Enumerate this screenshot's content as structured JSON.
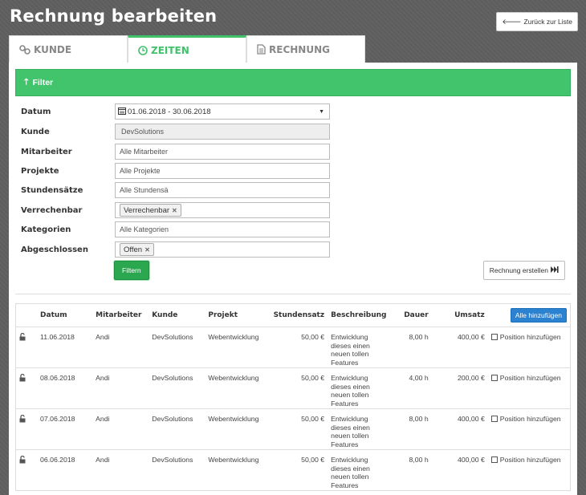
{
  "page": {
    "title": "Rechnung bearbeiten",
    "back_button": "Zurück zur Liste"
  },
  "tabs": [
    {
      "label": "KUNDE",
      "icon": "link-icon",
      "active": false
    },
    {
      "label": "ZEITEN",
      "icon": "clock-icon",
      "active": true
    },
    {
      "label": "RECHNUNG",
      "icon": "document-icon",
      "active": false
    }
  ],
  "filter": {
    "header": "Filter",
    "fields": {
      "datum": {
        "label": "Datum",
        "value": "01.06.2018 - 30.06.2018"
      },
      "kunde": {
        "label": "Kunde",
        "value": "DevSolutions"
      },
      "mitarbeiter": {
        "label": "Mitarbeiter",
        "placeholder": "Alle Mitarbeiter"
      },
      "projekte": {
        "label": "Projekte",
        "placeholder": "Alle Projekte"
      },
      "stundensaetze": {
        "label": "Stundensätze",
        "placeholder": "Alle Stundensä"
      },
      "verrechenbar": {
        "label": "Verrechenbar",
        "tag": "Verrechenbar"
      },
      "kategorien": {
        "label": "Kategorien",
        "placeholder": "Alle Kategorien"
      },
      "abgeschlossen": {
        "label": "Abgeschlossen",
        "tag": "Offen"
      }
    },
    "filter_button": "Filtern",
    "create_invoice_button": "Rechnung erstellen"
  },
  "table": {
    "columns": {
      "datum": "Datum",
      "mitarbeiter": "Mitarbeiter",
      "kunde": "Kunde",
      "projekt": "Projekt",
      "stundensatz": "Stundensatz",
      "beschreibung": "Beschreibung",
      "dauer": "Dauer",
      "umsatz": "Umsatz"
    },
    "add_all_button": "Alle hinzufügen",
    "add_position_label": "Position hinzufügen",
    "rows": [
      {
        "datum": "11.06.2018",
        "mitarbeiter": "Andi",
        "kunde": "DevSolutions",
        "projekt": "Webentwicklung",
        "stundensatz": "50,00 €",
        "beschreibung": "Entwicklung dieses einen neuen tollen Features",
        "dauer": "8,00 h",
        "umsatz": "400,00 €"
      },
      {
        "datum": "08.06.2018",
        "mitarbeiter": "Andi",
        "kunde": "DevSolutions",
        "projekt": "Webentwicklung",
        "stundensatz": "50,00 €",
        "beschreibung": "Entwicklung dieses einen neuen tollen Features",
        "dauer": "4,00 h",
        "umsatz": "200,00 €"
      },
      {
        "datum": "07.06.2018",
        "mitarbeiter": "Andi",
        "kunde": "DevSolutions",
        "projekt": "Webentwicklung",
        "stundensatz": "50,00 €",
        "beschreibung": "Entwicklung dieses einen neuen tollen Features",
        "dauer": "8,00 h",
        "umsatz": "400,00 €"
      },
      {
        "datum": "06.06.2018",
        "mitarbeiter": "Andi",
        "kunde": "DevSolutions",
        "projekt": "Webentwicklung",
        "stundensatz": "50,00 €",
        "beschreibung": "Entwicklung dieses einen neuen tollen Features",
        "dauer": "8,00 h",
        "umsatz": "400,00 €"
      }
    ]
  },
  "colors": {
    "accent": "#42c46c",
    "primary_button": "#2a82d0",
    "background": "#5f5f5f"
  }
}
